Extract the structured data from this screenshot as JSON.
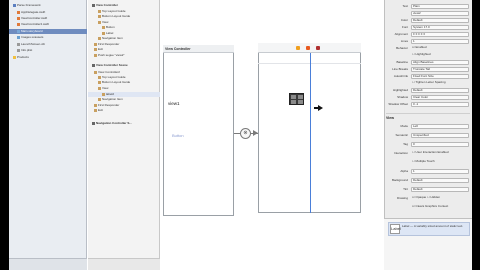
{
  "navigator": {
    "items": [
      {
        "label": "Parse Framework",
        "selected": false
      },
      {
        "label": "AppDelegate.swift",
        "selected": false
      },
      {
        "label": "ViewController.swift",
        "selected": false
      },
      {
        "label": "ViewController2.swift",
        "selected": false
      },
      {
        "label": "Main.storyboard",
        "selected": true
      },
      {
        "label": "Images.xcassets",
        "selected": false
      },
      {
        "label": "LaunchScreen.xib",
        "selected": false
      },
      {
        "label": "Info.plist",
        "selected": false
      },
      {
        "label": "Products",
        "selected": false
      }
    ]
  },
  "outline": {
    "items": [
      {
        "label": "View Controller",
        "head": true
      },
      {
        "label": "Top Layout Guide",
        "head": false
      },
      {
        "label": "Bottom Layout Guide",
        "head": false
      },
      {
        "label": "View",
        "head": false
      },
      {
        "label": "Button",
        "head": false
      },
      {
        "label": "Label",
        "head": false
      },
      {
        "label": "Navigation Item",
        "head": false
      },
      {
        "label": "First Responder",
        "head": false
      },
      {
        "label": "Exit",
        "head": false
      },
      {
        "label": "Push segue \"view2\"",
        "head": false
      },
      {
        "label": "View Controller Scene",
        "head": true
      },
      {
        "label": "View Controller2",
        "head": false
      },
      {
        "label": "Top Layout Guide",
        "head": false
      },
      {
        "label": "Bottom Layout Guide",
        "head": false
      },
      {
        "label": "View",
        "head": false
      },
      {
        "label": "label2",
        "head": false,
        "selected": true
      },
      {
        "label": "Navigation Item",
        "head": false
      },
      {
        "label": "First Responder",
        "head": false
      },
      {
        "label": "Exit",
        "head": false
      },
      {
        "label": "Navigation Controller S...",
        "head": true
      }
    ]
  },
  "canvas": {
    "vc1_title": "View Controller",
    "vc1_label": "view1",
    "vc1_button": "Button",
    "segue_glyph": "⊗"
  },
  "inspector": {
    "rows": [
      {
        "key": "Text",
        "value": "Plain"
      },
      {
        "key": "",
        "value": "view2"
      },
      {
        "key": "Color",
        "value": "Default"
      },
      {
        "key": "Font",
        "value": "System 17.0"
      },
      {
        "key": "Alignment",
        "value": "≡ ≡ ≡ ≡ ≡"
      },
      {
        "key": "Lines",
        "value": "1"
      },
      {
        "key": "Behavior",
        "value": "☑ Enabled"
      },
      {
        "key": "",
        "value": "☐ Highlighted"
      },
      {
        "key": "Baseline",
        "value": "Align Baselines"
      },
      {
        "key": "Line Breaks",
        "value": "Truncate Tail"
      },
      {
        "key": "Autoshrink",
        "value": "Fixed Font Size"
      },
      {
        "key": "",
        "value": "☐ Tighten Letter Spacing"
      },
      {
        "key": "Highlighted",
        "value": "Default"
      },
      {
        "key": "Shadow",
        "value": "Clear Color"
      },
      {
        "key": "Shadow Offset",
        "value": "0     -1"
      }
    ],
    "view_header": "View",
    "view_rows": [
      {
        "key": "Mode",
        "value": "Left"
      },
      {
        "key": "Semantic",
        "value": "Unspecified"
      },
      {
        "key": "Tag",
        "value": "0"
      },
      {
        "key": "Interaction",
        "value": "☐ User Interaction Enabled"
      },
      {
        "key": "",
        "value": "☐ Multiple Touch"
      },
      {
        "key": "Alpha",
        "value": "1"
      },
      {
        "key": "Background",
        "value": "Default"
      },
      {
        "key": "Tint",
        "value": "Default"
      },
      {
        "key": "Drawing",
        "value": "☑ Opaque  ☐ Hidden"
      },
      {
        "key": "",
        "value": "☑ Clears Graphics Context"
      }
    ],
    "library": {
      "icon": "Label",
      "text": "Label — A variably sized amount of static text."
    }
  }
}
